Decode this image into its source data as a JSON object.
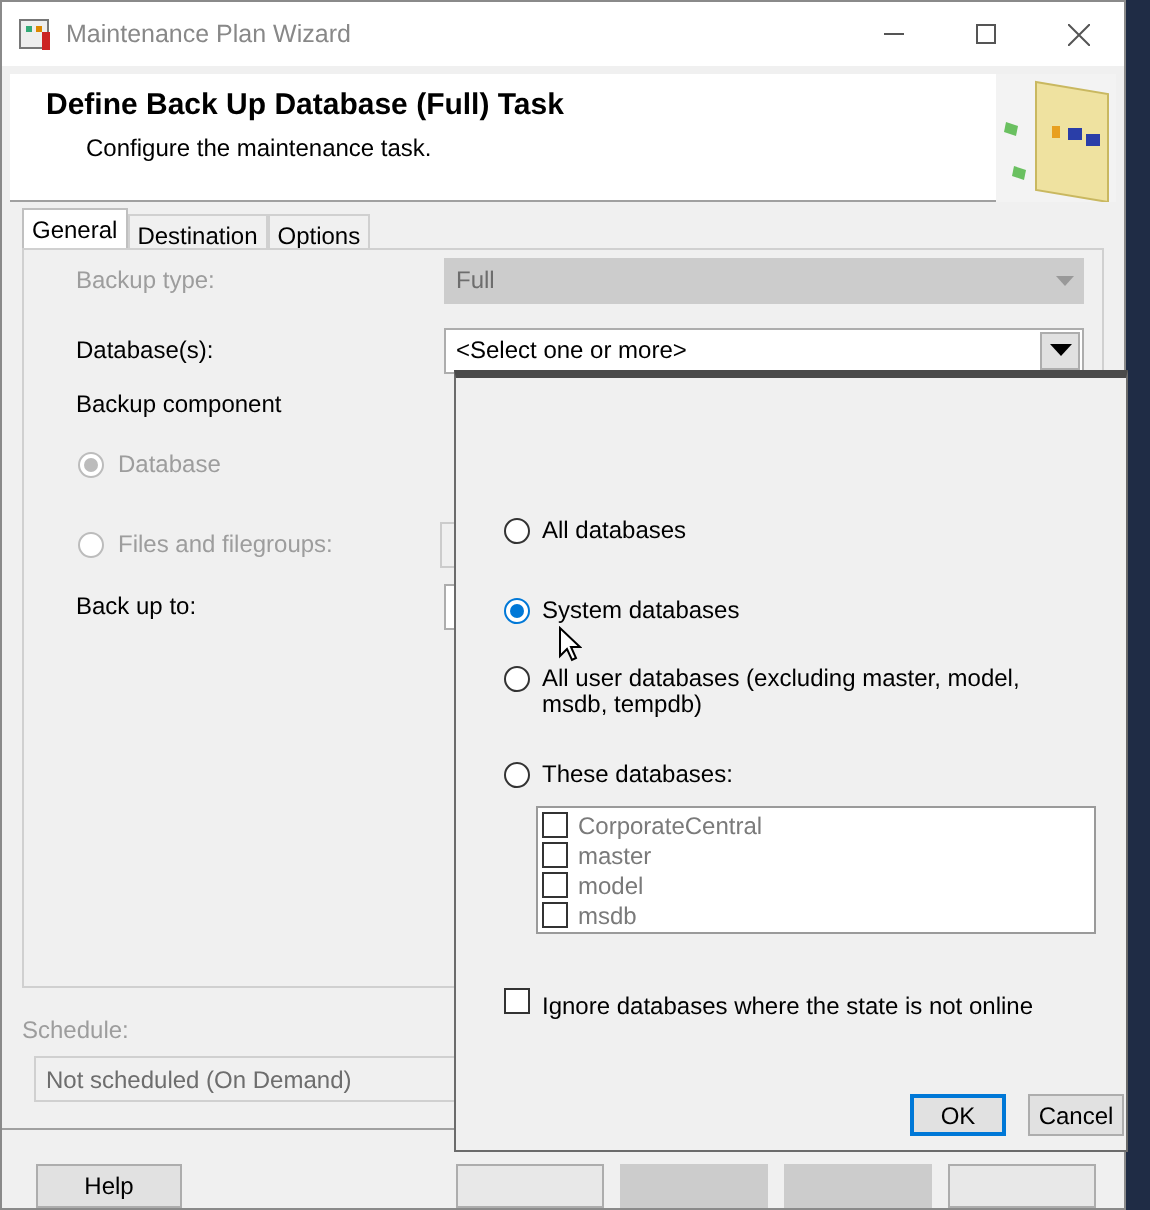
{
  "window": {
    "title": "Maintenance Plan Wizard"
  },
  "header": {
    "title": "Define Back Up Database (Full) Task",
    "subtitle": "Configure the maintenance task."
  },
  "tabs": [
    {
      "label": "General",
      "selected": true
    },
    {
      "label": "Destination",
      "selected": false
    },
    {
      "label": "Options",
      "selected": false
    }
  ],
  "form": {
    "backup_type": {
      "label": "Backup type:",
      "value": "Full",
      "disabled": true
    },
    "databases": {
      "label": "Database(s):",
      "value": "<Select one or more>",
      "disabled": false
    },
    "backup_component": {
      "label": "Backup component",
      "options": [
        {
          "label": "Database",
          "selected": true,
          "disabled": true
        },
        {
          "label": "Files and filegroups:",
          "selected": false,
          "disabled": true
        }
      ]
    },
    "back_up_to": {
      "label": "Back up to:"
    }
  },
  "schedule": {
    "label": "Schedule:",
    "value": "Not scheduled (On Demand)",
    "disabled": true
  },
  "footer_buttons": [
    {
      "label": "Help"
    }
  ],
  "popup": {
    "options": [
      {
        "label": "All databases",
        "selected": false
      },
      {
        "label": "System databases",
        "selected": true
      },
      {
        "label": "All user databases  (excluding master, model, msdb, tempdb)",
        "selected": false
      },
      {
        "label": "These databases:",
        "selected": false
      }
    ],
    "database_list": {
      "disabled": true,
      "items": [
        {
          "label": "CorporateCentral",
          "checked": false
        },
        {
          "label": "master",
          "checked": false
        },
        {
          "label": "model",
          "checked": false
        },
        {
          "label": "msdb",
          "checked": false
        }
      ]
    },
    "ignore_offline": {
      "label": "Ignore databases where the state is not online",
      "checked": false
    },
    "buttons": [
      {
        "label": "OK",
        "default": true
      },
      {
        "label": "Cancel",
        "default": false
      }
    ]
  }
}
